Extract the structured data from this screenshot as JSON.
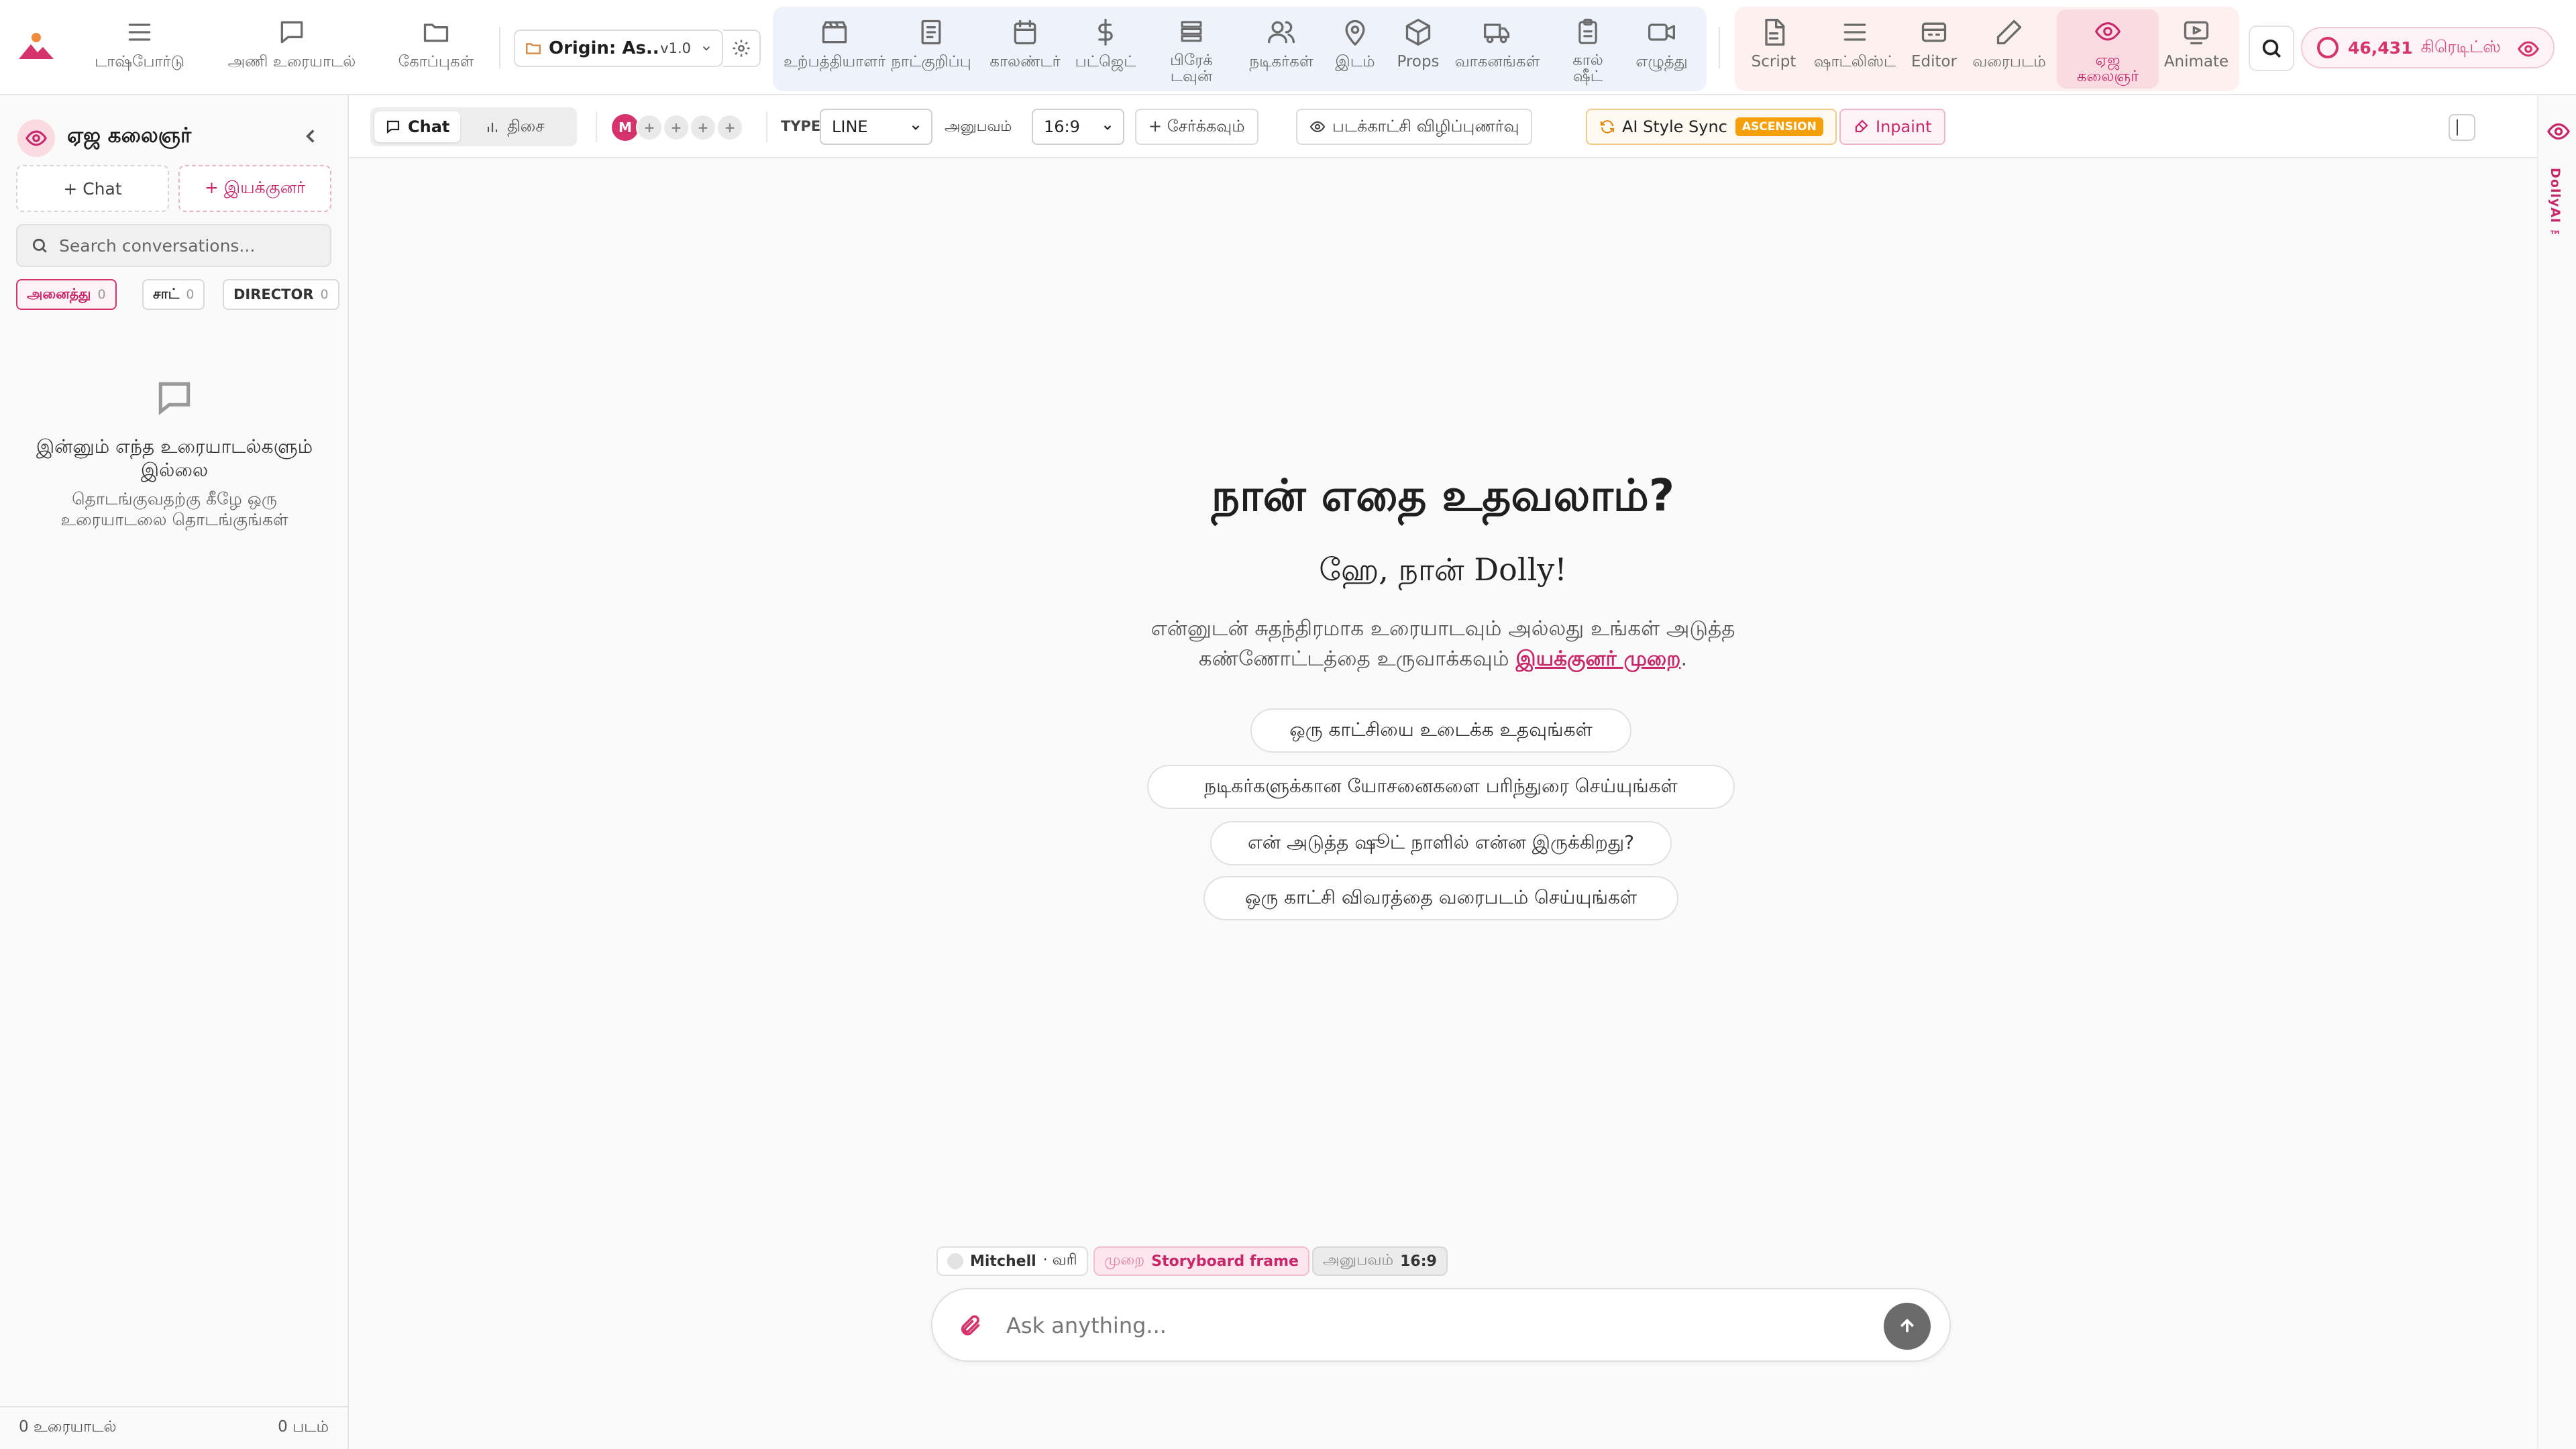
{
  "nav_left": [
    {
      "label": "டாஷ்போர்டு",
      "icon": "menu-icon"
    },
    {
      "label": "அணி உரையாடல்",
      "icon": "chat-bubble-icon"
    },
    {
      "label": "கோப்புகள்",
      "icon": "folder-icon"
    }
  ],
  "project": {
    "name": "Origin: As...",
    "version": "v1.0"
  },
  "nav_production": [
    {
      "label": "உற்பத்தியாளர்",
      "icon": "clapperboard-icon"
    },
    {
      "label": "நாட்குறிப்பு",
      "icon": "notebook-icon"
    },
    {
      "label": "காலண்டர்",
      "icon": "calendar-icon"
    },
    {
      "label": "பட்ஜெட்",
      "icon": "dollar-icon"
    },
    {
      "label": "பிரேக் டவுன்",
      "icon": "layers-icon"
    },
    {
      "label": "நடிகர்கள்",
      "icon": "users-icon"
    },
    {
      "label": "இடம்",
      "icon": "map-pin-icon"
    },
    {
      "label": "Props",
      "icon": "box-icon"
    },
    {
      "label": "வாகனங்கள்",
      "icon": "truck-icon"
    },
    {
      "label": "கால் ஷீட்",
      "icon": "clipboard-icon"
    },
    {
      "label": "எழுத்து",
      "icon": "video-camera-icon"
    }
  ],
  "nav_creative": [
    {
      "label": "Script",
      "icon": "document-icon"
    },
    {
      "label": "ஷாட்லிஸ்ட்",
      "icon": "list-icon"
    },
    {
      "label": "Editor",
      "icon": "editor-icon"
    },
    {
      "label": "வரைபடம்",
      "icon": "pencil-icon"
    },
    {
      "label": "ஏஜ கலைஞர்",
      "icon": "eye-icon",
      "active": true
    },
    {
      "label": "Animate",
      "icon": "play-icon"
    }
  ],
  "credits": {
    "value": "46,431",
    "label": "கிரெடிட்ஸ்"
  },
  "sidebar": {
    "title": "ஏஜ கலைஞர்",
    "new_chat": "+ Chat",
    "new_director": "+ இயக்குனர்",
    "search_placeholder": "Search conversations...",
    "filters": [
      {
        "label": "அனைத்து",
        "count": "0",
        "active": true
      },
      {
        "label": "சாட்",
        "count": "0"
      },
      {
        "label": "DIRECTOR",
        "count": "0"
      }
    ],
    "empty_title": "இன்னும் எந்த உரையாடல்களும் இல்லை",
    "empty_sub": "தொடங்குவதற்கு கீழே ஒரு உரையாடலை தொடங்குங்கள்",
    "footer_left": "0 உரையாடல்",
    "footer_right": "0 படம்"
  },
  "toolbar": {
    "tab_chat": "Chat",
    "tab_direction": "திசை",
    "avatar_initial": "M",
    "avatar_add": "+",
    "type_label": "TYPE",
    "type_value": "LINE",
    "aspect_label": "அனுபவம்",
    "aspect_value": "16:9",
    "add_label": "+ சேர்க்கவும்",
    "preview_label": "படக்காட்சி விழிப்புணர்வு",
    "style_sync_label": "AI Style Sync",
    "style_sync_badge": "ASCENSION",
    "inpaint_label": "Inpaint"
  },
  "rail": {
    "label": "DollyAI ™"
  },
  "main": {
    "heading": "நான் எதை உதவலாம்?",
    "greeting": "ஹே, நான் Dolly!",
    "intro_text": "என்னுடன் சுதந்திரமாக உரையாடவும் அல்லது உங்கள் அடுத்த கண்ணோட்டத்தை உருவாக்கவும்",
    "intro_link": "இயக்குனர் முறை",
    "intro_end": ".",
    "suggestions": [
      "ஒரு காட்சியை உடைக்க உதவுங்கள்",
      "நடிகர்களுக்கான யோசனைகளை பரிந்துரை செய்யுங்கள்",
      "என் அடுத்த ஷூட் நாளில் என்ன இருக்கிறது?",
      "ஒரு காட்சி விவரத்தை வரைபடம் செய்யுங்கள்"
    ]
  },
  "composer": {
    "user_name": "Mitchell",
    "user_role": "· வரி",
    "mode_label": "முறை",
    "mode_value": "Storyboard frame",
    "aspect_label": "அனுபவம்",
    "aspect_value": "16:9",
    "placeholder": "Ask anything..."
  },
  "colors": {
    "accent": "#c82869",
    "warning": "#f59f0b",
    "primary_text": "#1f1f1f"
  }
}
